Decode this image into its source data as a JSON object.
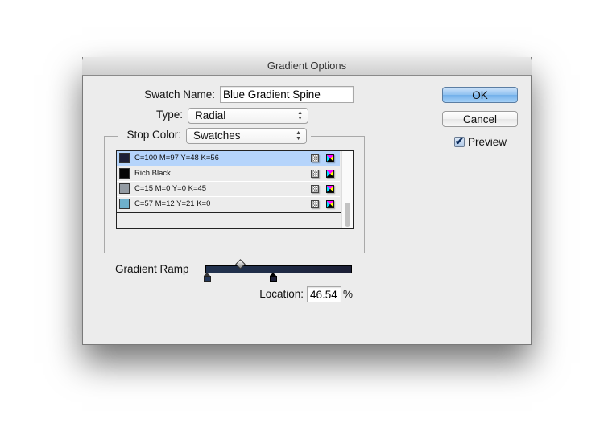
{
  "window": {
    "title": "Gradient Options"
  },
  "form": {
    "swatch_name_label": "Swatch Name:",
    "swatch_name_value": "Blue Gradient Spine",
    "type_label": "Type:",
    "type_value": "Radial",
    "stop_color_label": "Stop Color:",
    "stop_color_value": "Swatches"
  },
  "swatches": [
    {
      "name": "C=100 M=97 Y=48 K=56",
      "color": "#1e2038",
      "selected": true
    },
    {
      "name": "Rich Black",
      "color": "#050505",
      "selected": false
    },
    {
      "name": "C=15 M=0 Y=0 K=45",
      "color": "#939ba3",
      "selected": false
    },
    {
      "name": "C=57 M=12 Y=21 K=0",
      "color": "#6eb0cc",
      "selected": false
    }
  ],
  "swatch_icons": {
    "color_type": "process-color-icon",
    "color_mode": "cmyk-icon"
  },
  "ramp": {
    "label": "Gradient Ramp",
    "location_label": "Location:",
    "location_value": "46.54",
    "location_unit": "%",
    "stops": [
      {
        "location_percent": 0,
        "color": "#24385a"
      },
      {
        "location_percent": 46.54,
        "color": "#1e2038"
      }
    ],
    "midpoint_percent": 23
  },
  "buttons": {
    "ok": "OK",
    "cancel": "Cancel"
  },
  "preview": {
    "label": "Preview",
    "checked": true,
    "check_glyph": "✔"
  },
  "arrows_glyph": "▲▼"
}
